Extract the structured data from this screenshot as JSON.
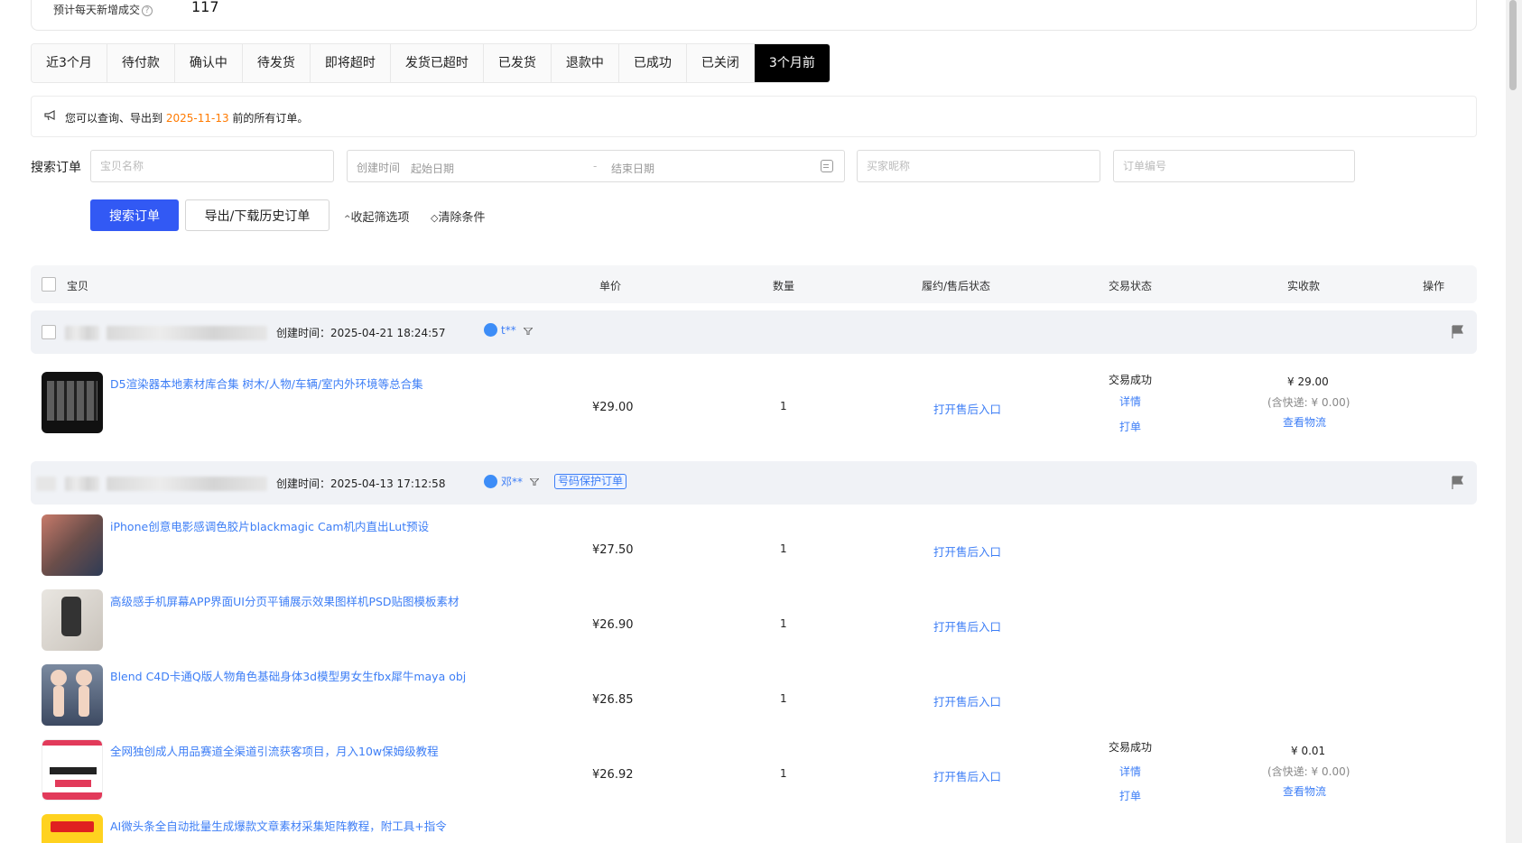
{
  "stat": {
    "label": "预计每天新增成交",
    "value": "117"
  },
  "tabs": [
    "近3个月",
    "待付款",
    "确认中",
    "待发货",
    "即将超时",
    "发货已超时",
    "已发货",
    "退款中",
    "已成功",
    "已关闭",
    "3个月前"
  ],
  "active_tab": "3个月前",
  "notice": {
    "prefix": "您可以查询、导出到",
    "date": "2025-11-13",
    "suffix": "前的所有订单。"
  },
  "search": {
    "label": "搜索订单",
    "item_placeholder": "宝贝名称",
    "created_label": "创建时间",
    "start_placeholder": "起始日期",
    "range_sep": "-",
    "end_placeholder": "结束日期",
    "buyer_placeholder": "买家昵称",
    "order_no_placeholder": "订单编号",
    "search_btn": "搜索订单",
    "export_btn": "导出/下载历史订单",
    "collapse": "收起筛选项",
    "clear": "清除条件"
  },
  "table_header": {
    "item": "宝贝",
    "unit_price": "单价",
    "quantity": "数量",
    "after_sale": "履约/售后状态",
    "trade_status": "交易状态",
    "received": "实收款",
    "action": "操作"
  },
  "orders": [
    {
      "created": "创建时间：2025-04-21 18:24:57",
      "buyer": "t**",
      "status": "交易成功",
      "detail": "详情",
      "print": "打单",
      "amount": "¥ 29.00",
      "shipping": "(含快递: ¥ 0.00)",
      "logistics": "查看物流",
      "items": [
        {
          "title": "D5渲染器本地素材库合集 树木/人物/车辆/室内外环境等总合集",
          "price": "¥29.00",
          "qty": "1",
          "after_sale": "打开售后入口"
        }
      ]
    },
    {
      "created": "创建时间：2025-04-13 17:12:58",
      "buyer": "邓**",
      "badge": "号码保护订单",
      "status": "交易成功",
      "detail": "详情",
      "print": "打单",
      "amount": "¥ 0.01",
      "shipping": "(含快递: ¥ 0.00)",
      "logistics": "查看物流",
      "items": [
        {
          "title": "iPhone创意电影感调色胶片blackmagic Cam机内直出Lut预设",
          "price": "¥27.50",
          "qty": "1",
          "after_sale": "打开售后入口"
        },
        {
          "title": "高级感手机屏幕APP界面UI分页平铺展示效果图样机PSD贴图模板素材",
          "price": "¥26.90",
          "qty": "1",
          "after_sale": "打开售后入口"
        },
        {
          "title": "Blend C4D卡通Q版人物角色基础身体3d模型男女生fbx犀牛maya obj",
          "price": "¥26.85",
          "qty": "1",
          "after_sale": "打开售后入口"
        },
        {
          "title": "全网独创成人用品赛道全渠道引流获客项目，月入10w保姆级教程",
          "price": "¥26.92",
          "qty": "1",
          "after_sale": "打开售后入口"
        },
        {
          "title": "AI微头条全自动批量生成爆款文章素材采集矩阵教程，附工具+指令",
          "price": "",
          "qty": "",
          "after_sale": ""
        }
      ]
    }
  ],
  "colors": {
    "primary": "#3259f4",
    "link": "#3d7ef6",
    "notice_date": "#ff7a00",
    "active_tab_bg": "#000000"
  }
}
